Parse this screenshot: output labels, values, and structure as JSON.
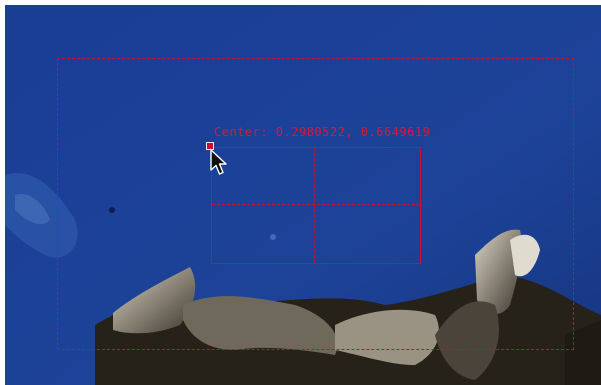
{
  "overlay": {
    "center_readout": "Center: 0.2980522, 0.6649619",
    "accent_color": "#c8102e",
    "background_color": "#1b3f93"
  },
  "icons": {
    "handle": "corner-resize-handle",
    "pointer": "arrow-cursor-icon"
  }
}
